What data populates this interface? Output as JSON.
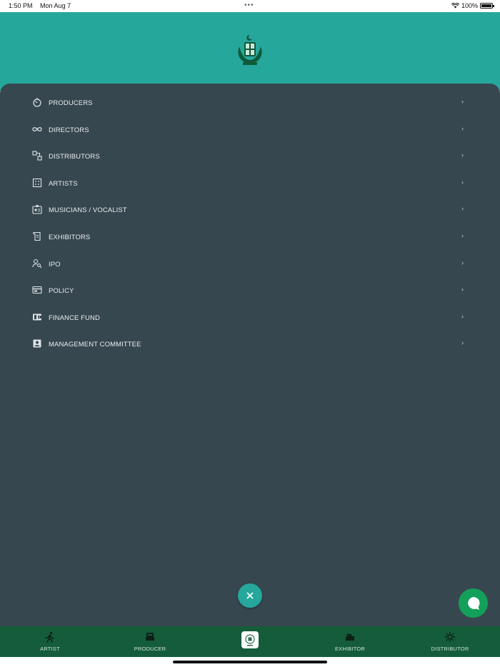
{
  "status_bar": {
    "time": "1:50 PM",
    "date": "Mon Aug 7",
    "battery": "100%"
  },
  "menu": {
    "items": [
      {
        "label": "PRODUCERS",
        "icon": "timer-icon"
      },
      {
        "label": "DIRECTORS",
        "icon": "infinity-icon"
      },
      {
        "label": "DISTRIBUTORS",
        "icon": "nodes-icon"
      },
      {
        "label": "ARTISTS",
        "icon": "grid-icon"
      },
      {
        "label": "MUSICIANS / VOCALIST",
        "icon": "id-badge-icon"
      },
      {
        "label": "EXHIBITORS",
        "icon": "document-icon"
      },
      {
        "label": "IPO",
        "icon": "person-search-icon"
      },
      {
        "label": "POLICY",
        "icon": "card-icon"
      },
      {
        "label": "FINANCE FUND",
        "icon": "wallet-icon"
      },
      {
        "label": "MANAGEMENT COMMITTEE",
        "icon": "contact-icon"
      }
    ],
    "chevron": "›"
  },
  "tabbar": {
    "tabs": [
      {
        "label": "ARTIST",
        "icon": "runner-icon"
      },
      {
        "label": "PRODUCER",
        "icon": "producer-icon"
      },
      {
        "label": "",
        "icon": "app-logo-icon"
      },
      {
        "label": "EXHIBITOR",
        "icon": "exhibitor-icon"
      },
      {
        "label": "DISTRIBUTOR",
        "icon": "distributor-icon"
      }
    ]
  },
  "colors": {
    "header": "#26a79c",
    "panel": "#37474f",
    "tabbar": "#145c3a",
    "chat": "#13a05a"
  }
}
